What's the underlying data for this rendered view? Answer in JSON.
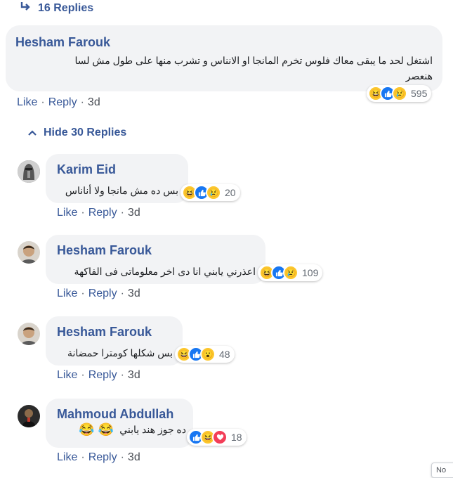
{
  "top_replies": {
    "label": "16 Replies"
  },
  "main_comment": {
    "author": "Hesham Farouk",
    "text_line1": "اشتغل لحد ما يبقى معاك فلوس تخرم المانجا او الانناس و تشرب منها على طول مش لسا",
    "text_line2": "هنعصر",
    "reaction_count": "595",
    "reactions": [
      "haha-icon",
      "like-icon",
      "sad-icon"
    ]
  },
  "actions": {
    "like": "Like",
    "reply": "Reply",
    "sep": "·"
  },
  "main_time": "3d",
  "hide_replies": {
    "label": "Hide 30 Replies"
  },
  "replies": [
    {
      "author": "Karim Eid",
      "text": "بس ده مش مانجا ولا أناناس",
      "count": "20",
      "time": "3d"
    },
    {
      "author": "Hesham Farouk",
      "text": "اعذرني يابني انا دى اخر معلوماتى فى الفاكهة",
      "count": "109",
      "time": "3d"
    },
    {
      "author": "Hesham Farouk",
      "text": "بس شكلها كومترا حمضانة",
      "count": "48",
      "time": "3d"
    },
    {
      "author": "Mahmoud Abdullah",
      "text": "ده جوز هند يابني",
      "emoji": "😂 😂",
      "count": "18",
      "time": "3d"
    }
  ],
  "corner_text": "No",
  "colors": {
    "link": "#385898",
    "bubble": "#f2f3f5",
    "like": "#1877f2",
    "love": "#f33e58",
    "haha": "#fcc72d"
  }
}
